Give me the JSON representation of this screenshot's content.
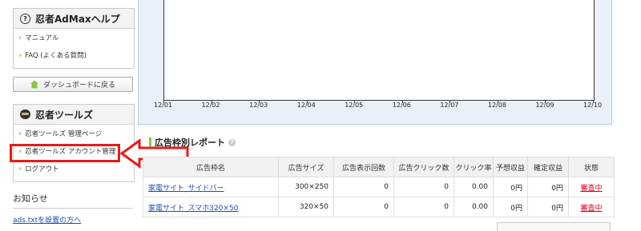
{
  "help_box": {
    "title": "忍者AdMaxヘルプ",
    "items": [
      {
        "label": "マニュアル"
      },
      {
        "label": "FAQ (よくある質問)"
      }
    ]
  },
  "dashboard_button": {
    "label": "ダッシュボードに戻る"
  },
  "tools_box": {
    "title": "忍者ツールズ",
    "items": [
      {
        "label": "忍者ツールズ 管理ページ"
      },
      {
        "label": "忍者ツールズ アカウント管理"
      },
      {
        "label": "ログアウト"
      }
    ]
  },
  "news": {
    "title": "お知らせ",
    "link": "ads.txtを設置の方へ"
  },
  "chart": {
    "x_labels": [
      "12/01",
      "12/02",
      "12/03",
      "12/04",
      "12/05",
      "12/06",
      "12/07",
      "12/08",
      "12/09",
      "12/10"
    ]
  },
  "report": {
    "title": "広告枠別レポート",
    "columns": [
      "広告枠名",
      "広告サイズ",
      "広告表示回数",
      "広告クリック数",
      "クリック率",
      "予想収益",
      "確定収益",
      "状態"
    ],
    "rows": [
      {
        "name": "家電サイト_サイドバー",
        "size": "300×250",
        "impressions": "0",
        "clicks": "0",
        "ctr": "0.00",
        "est": "0円",
        "confirmed": "0円",
        "status": "審査中"
      },
      {
        "name": "家電サイト_スマホ320×50",
        "size": "320×50",
        "impressions": "0",
        "clicks": "0",
        "ctr": "0.00",
        "est": "0円",
        "confirmed": "0円",
        "status": "審査中"
      }
    ]
  },
  "colors": {
    "accent_green": "#8cc63f",
    "highlight_red": "#e81b1b",
    "link_blue": "#1a4fb5"
  }
}
